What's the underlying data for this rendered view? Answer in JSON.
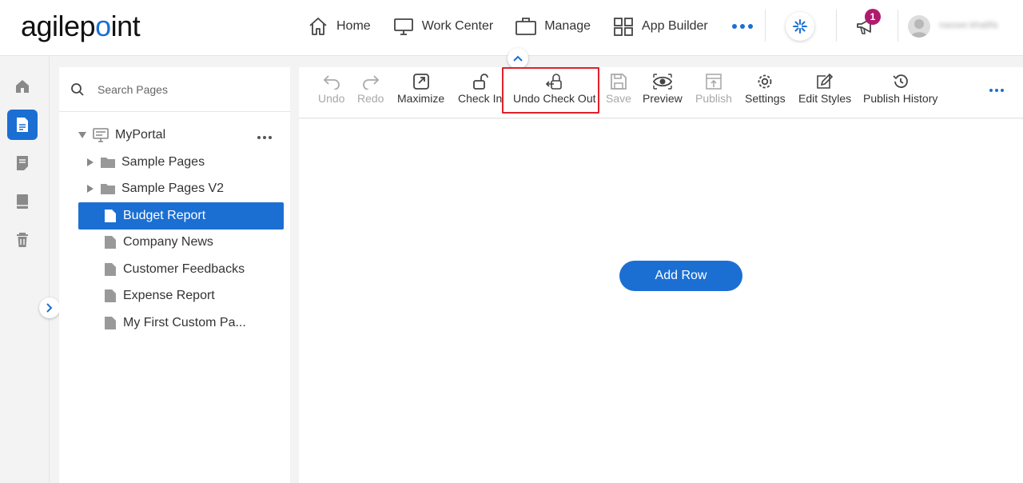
{
  "brand": {
    "logo_prefix": "agilep",
    "logo_dot": "o",
    "logo_suffix": "int"
  },
  "nav": {
    "items": [
      {
        "label": "Home",
        "icon": "home-icon"
      },
      {
        "label": "Work Center",
        "icon": "monitor-icon"
      },
      {
        "label": "Manage",
        "icon": "briefcase-icon"
      },
      {
        "label": "App Builder",
        "icon": "grid-icon"
      }
    ],
    "notification_count": "1",
    "username": "nasser.khalifa"
  },
  "search": {
    "placeholder": "Search Pages"
  },
  "tree": {
    "root": "MyPortal",
    "items": [
      {
        "label": "Sample Pages",
        "type": "folder"
      },
      {
        "label": "Sample Pages V2",
        "type": "folder"
      },
      {
        "label": "Budget Report",
        "type": "page",
        "selected": true
      },
      {
        "label": "Company News",
        "type": "page"
      },
      {
        "label": "Customer Feedbacks",
        "type": "page"
      },
      {
        "label": "Expense Report",
        "type": "page"
      },
      {
        "label": "My First Custom Pa...",
        "type": "page"
      }
    ]
  },
  "toolbar": {
    "undo": "Undo",
    "redo": "Redo",
    "maximize": "Maximize",
    "check_in": "Check In",
    "undo_check_out": "Undo Check Out",
    "save": "Save",
    "preview": "Preview",
    "publish": "Publish",
    "settings": "Settings",
    "edit_styles": "Edit Styles",
    "publish_history": "Publish History"
  },
  "canvas": {
    "add_row": "Add Row"
  },
  "colors": {
    "accent": "#1b6fd3",
    "badge": "#b01a6e",
    "highlight": "#e0202a"
  }
}
